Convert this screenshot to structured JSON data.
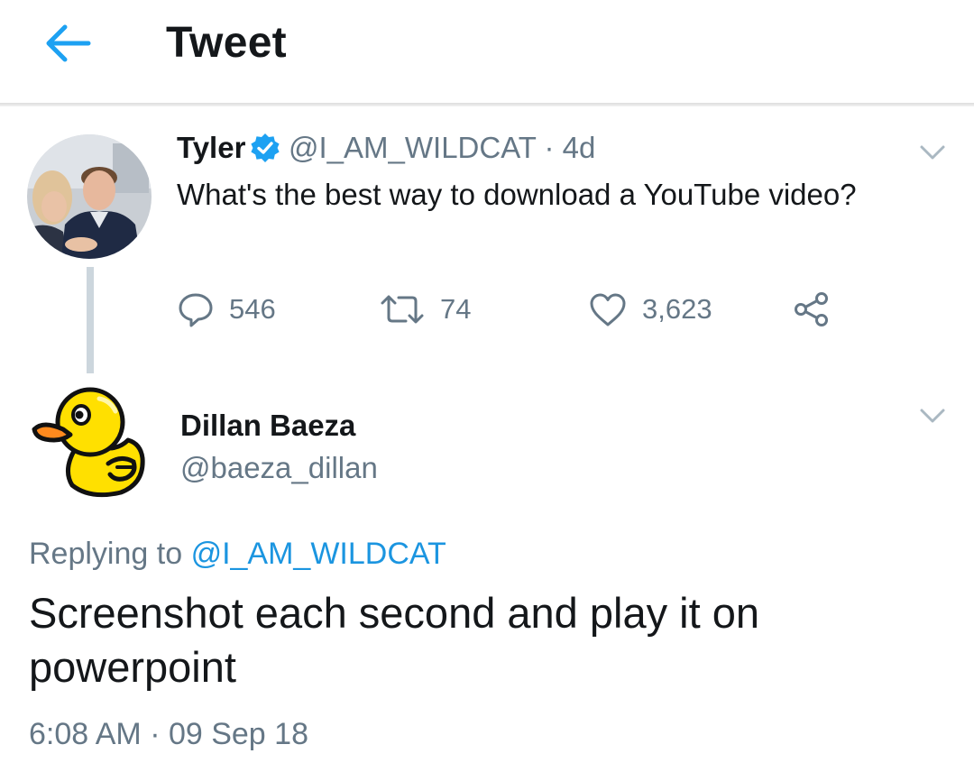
{
  "header": {
    "title": "Tweet",
    "back_icon": "arrow-left-icon",
    "accent_color": "#1da1f2"
  },
  "parent_tweet": {
    "name": "Tyler",
    "verified": true,
    "handle_time": "@I_AM_WILDCAT · 4d",
    "text": "What's the best way to download a YouTube video?",
    "actions": {
      "reply_count": "546",
      "retweet_count": "74",
      "like_count": "3,623"
    }
  },
  "reply_tweet": {
    "name": "Dillan Baeza",
    "handle": "@baeza_dillan",
    "replying_prefix": "Replying to",
    "replying_to": "@I_AM_WILDCAT",
    "text": "Screenshot each second and play it on powerpoint",
    "timestamp": "6:08 AM · 09 Sep 18"
  },
  "colors": {
    "text": "#14171a",
    "secondary": "#657786",
    "link": "#1b95e0",
    "thread_line": "#ccd6dd"
  }
}
